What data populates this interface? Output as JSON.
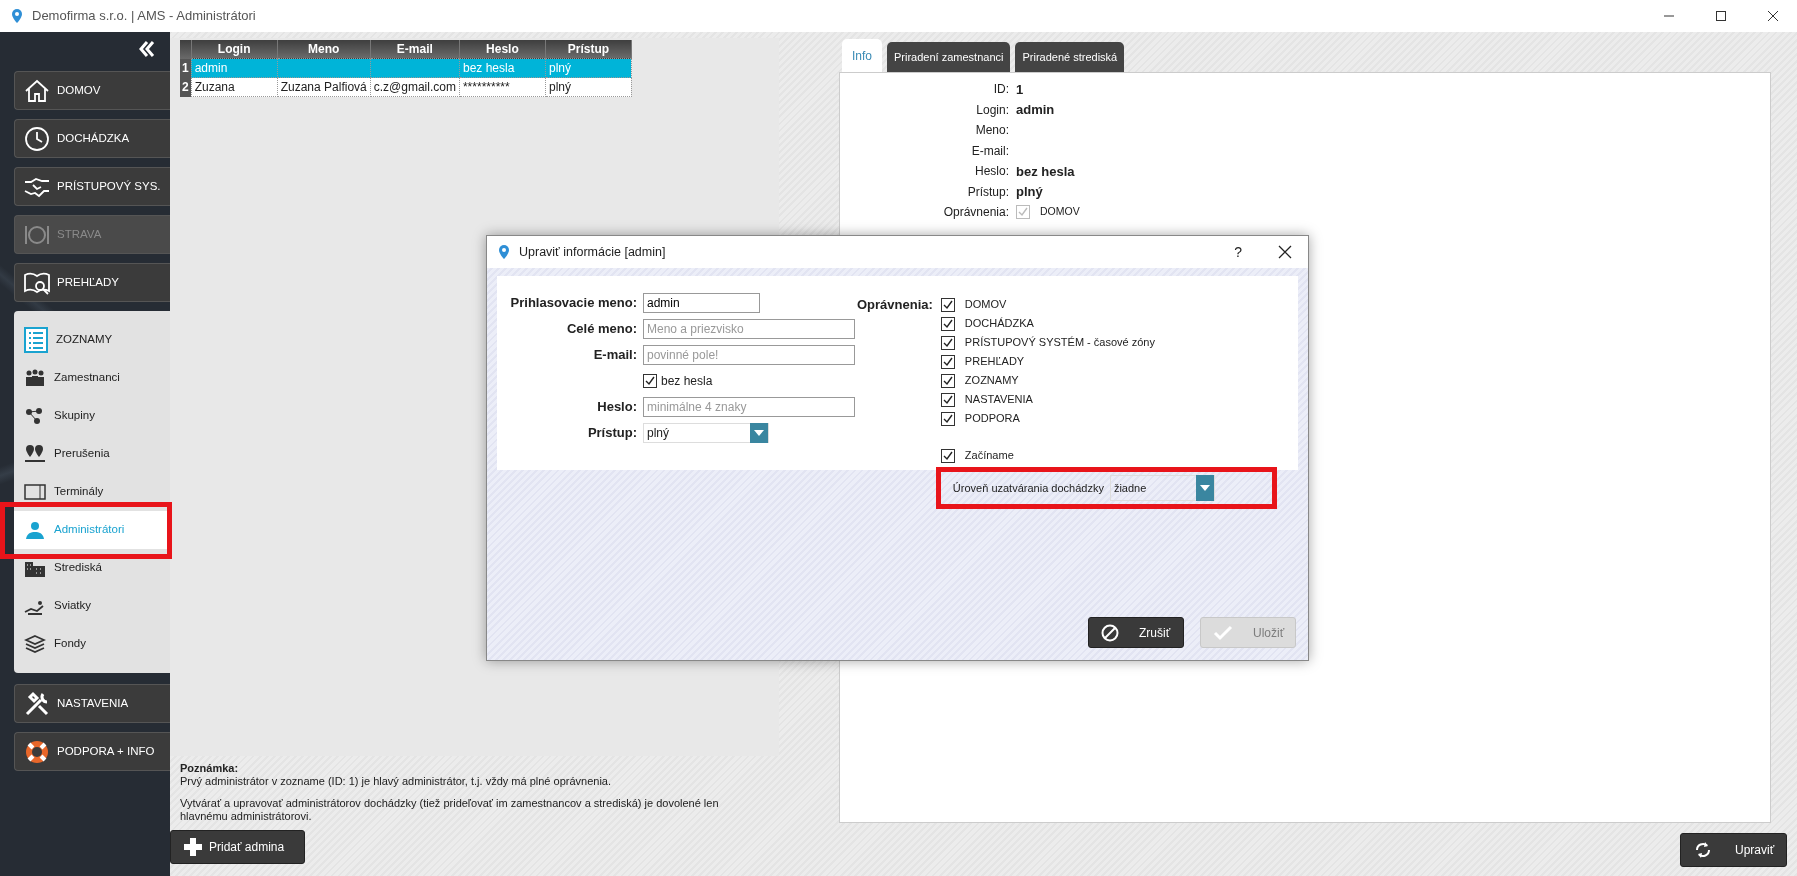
{
  "window": {
    "title": "Demofirma s.r.o. | AMS - Administrátori"
  },
  "sidebar": {
    "items": [
      {
        "label": "DOMOV",
        "disabled": false
      },
      {
        "label": "DOCHÁDZKA",
        "disabled": false
      },
      {
        "label": "PRÍSTUPOVÝ SYS.",
        "disabled": false
      },
      {
        "label": "STRAVA",
        "disabled": true
      },
      {
        "label": "PREHĽADY",
        "disabled": false
      }
    ],
    "submenu": {
      "title": "ZOZNAMY",
      "items": [
        {
          "label": "Zamestnanci",
          "selected": false,
          "highlighted": false
        },
        {
          "label": "Skupiny",
          "selected": false,
          "highlighted": false
        },
        {
          "label": "Prerušenia",
          "selected": false,
          "highlighted": false
        },
        {
          "label": "Terminály",
          "selected": false,
          "highlighted": false
        },
        {
          "label": "Administrátori",
          "selected": true,
          "highlighted": true
        },
        {
          "label": "Strediská",
          "selected": false,
          "highlighted": false
        },
        {
          "label": "Sviatky",
          "selected": false,
          "highlighted": false
        },
        {
          "label": "Fondy",
          "selected": false,
          "highlighted": false
        }
      ]
    },
    "items_after": [
      {
        "label": "NASTAVENIA",
        "disabled": false
      },
      {
        "label": "PODPORA + INFO",
        "disabled": false
      }
    ]
  },
  "table": {
    "columns": [
      "Login",
      "Meno",
      "E-mail",
      "Heslo",
      "Prístup"
    ],
    "rows": [
      {
        "number": "1",
        "selected": true,
        "cells": [
          "admin",
          null,
          null,
          "bez hesla",
          "plný"
        ]
      },
      {
        "number": "2",
        "selected": false,
        "cells": [
          "Zuzana",
          "Zuzana Palfiová",
          "c.z@gmail.com",
          "**********",
          "plný"
        ]
      }
    ]
  },
  "note": {
    "title": "Poznámka:",
    "paragraphs": [
      "Prvý administrátor v zozname (ID: 1) je hlavý administrátor, t.j. vždy má plné oprávnenia.",
      "Vytvárať a upravovať administrátorov dochádzky (tiež prideľovať im zamestnancov a strediská) je dovolené len hlavnému administrátorovi."
    ]
  },
  "add_button": {
    "label": "Pridať admina"
  },
  "tabs": [
    {
      "label": "Info",
      "selected": true
    },
    {
      "label": "Priradení zamestnanci",
      "selected": false
    },
    {
      "label": "Priradené strediská",
      "selected": false
    }
  ],
  "info": {
    "rows": [
      {
        "label": "ID:",
        "value": "1"
      },
      {
        "label": "Login:",
        "value": "admin"
      },
      {
        "label": "Meno:"
      },
      {
        "label": "E-mail:"
      },
      {
        "label": "Heslo:",
        "value": "bez hesla"
      },
      {
        "label": "Prístup:",
        "value": "plný"
      }
    ],
    "permissions": {
      "label": "Oprávnenia:",
      "items": [
        {
          "label": "DOMOV",
          "checked": true,
          "disabled": true
        }
      ]
    }
  },
  "edit_button": {
    "label": "Upraviť"
  },
  "dialog": {
    "title": "Upraviť informácie [admin]",
    "help": "?",
    "fields": [
      {
        "kind": "text",
        "label": "Prihlasovacie meno:",
        "value": "admin"
      },
      {
        "kind": "text",
        "label": "Celé meno:",
        "placeholder": "Meno a priezvisko"
      },
      {
        "kind": "text",
        "label": "E-mail:",
        "placeholder": "povinné pole!"
      },
      {
        "kind": "checkbox",
        "label": "bez hesla",
        "checked": true
      },
      {
        "kind": "text",
        "label": "Heslo:",
        "placeholder": "minimálne 4 znaky"
      },
      {
        "kind": "select",
        "label": "Prístup:",
        "value": "plný"
      }
    ],
    "permissions": {
      "label": "Oprávnenia:",
      "items": [
        {
          "label": "DOMOV",
          "checked": true
        },
        {
          "label": "DOCHÁDZKA",
          "checked": true
        },
        {
          "label": "PRÍSTUPOVÝ SYSTÉM - časové zóny",
          "checked": true
        },
        {
          "label": "PREHĽADY",
          "checked": true
        },
        {
          "label": "ZOZNAMY",
          "checked": true
        },
        {
          "label": "NASTAVENIA",
          "checked": true
        },
        {
          "label": "PODPORA",
          "checked": true
        }
      ]
    },
    "getting_started": {
      "label": "Začíname",
      "checked": true
    },
    "closing_level": {
      "label": "Úroveň uzatvárania dochádzky",
      "value": "žiadne",
      "highlighted": true
    },
    "buttons": [
      {
        "kind": "cancel",
        "label": "Zrušiť",
        "disabled": false
      },
      {
        "kind": "save",
        "label": "Uložiť",
        "disabled": true
      }
    ]
  }
}
